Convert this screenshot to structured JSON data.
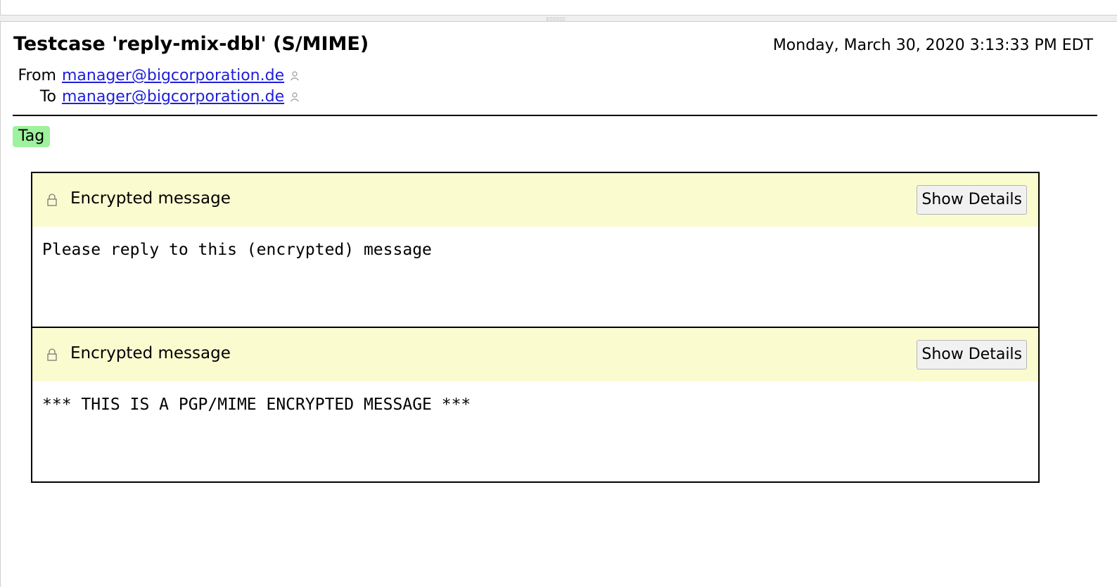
{
  "message": {
    "subject": "Testcase 'reply-mix-dbl' (S/MIME)",
    "date": "Monday, March 30, 2020 3:13:33 PM EDT",
    "from_label": "From",
    "from_address": "manager@bigcorporation.de",
    "to_label": "To",
    "to_address": "manager@bigcorporation.de",
    "tag": "Tag"
  },
  "parts": [
    {
      "status": "Encrypted message",
      "button": "Show Details",
      "body": "Please reply to this (encrypted) message",
      "icon": "lock-icon"
    },
    {
      "status": "Encrypted message",
      "button": "Show Details",
      "body": "*** THIS IS A PGP/MIME ENCRYPTED MESSAGE ***",
      "icon": "lock-icon"
    }
  ],
  "colors": {
    "tag_background": "#9ef29e",
    "encryption_bar": "#fbfbd0",
    "link": "#1f1fd9"
  }
}
